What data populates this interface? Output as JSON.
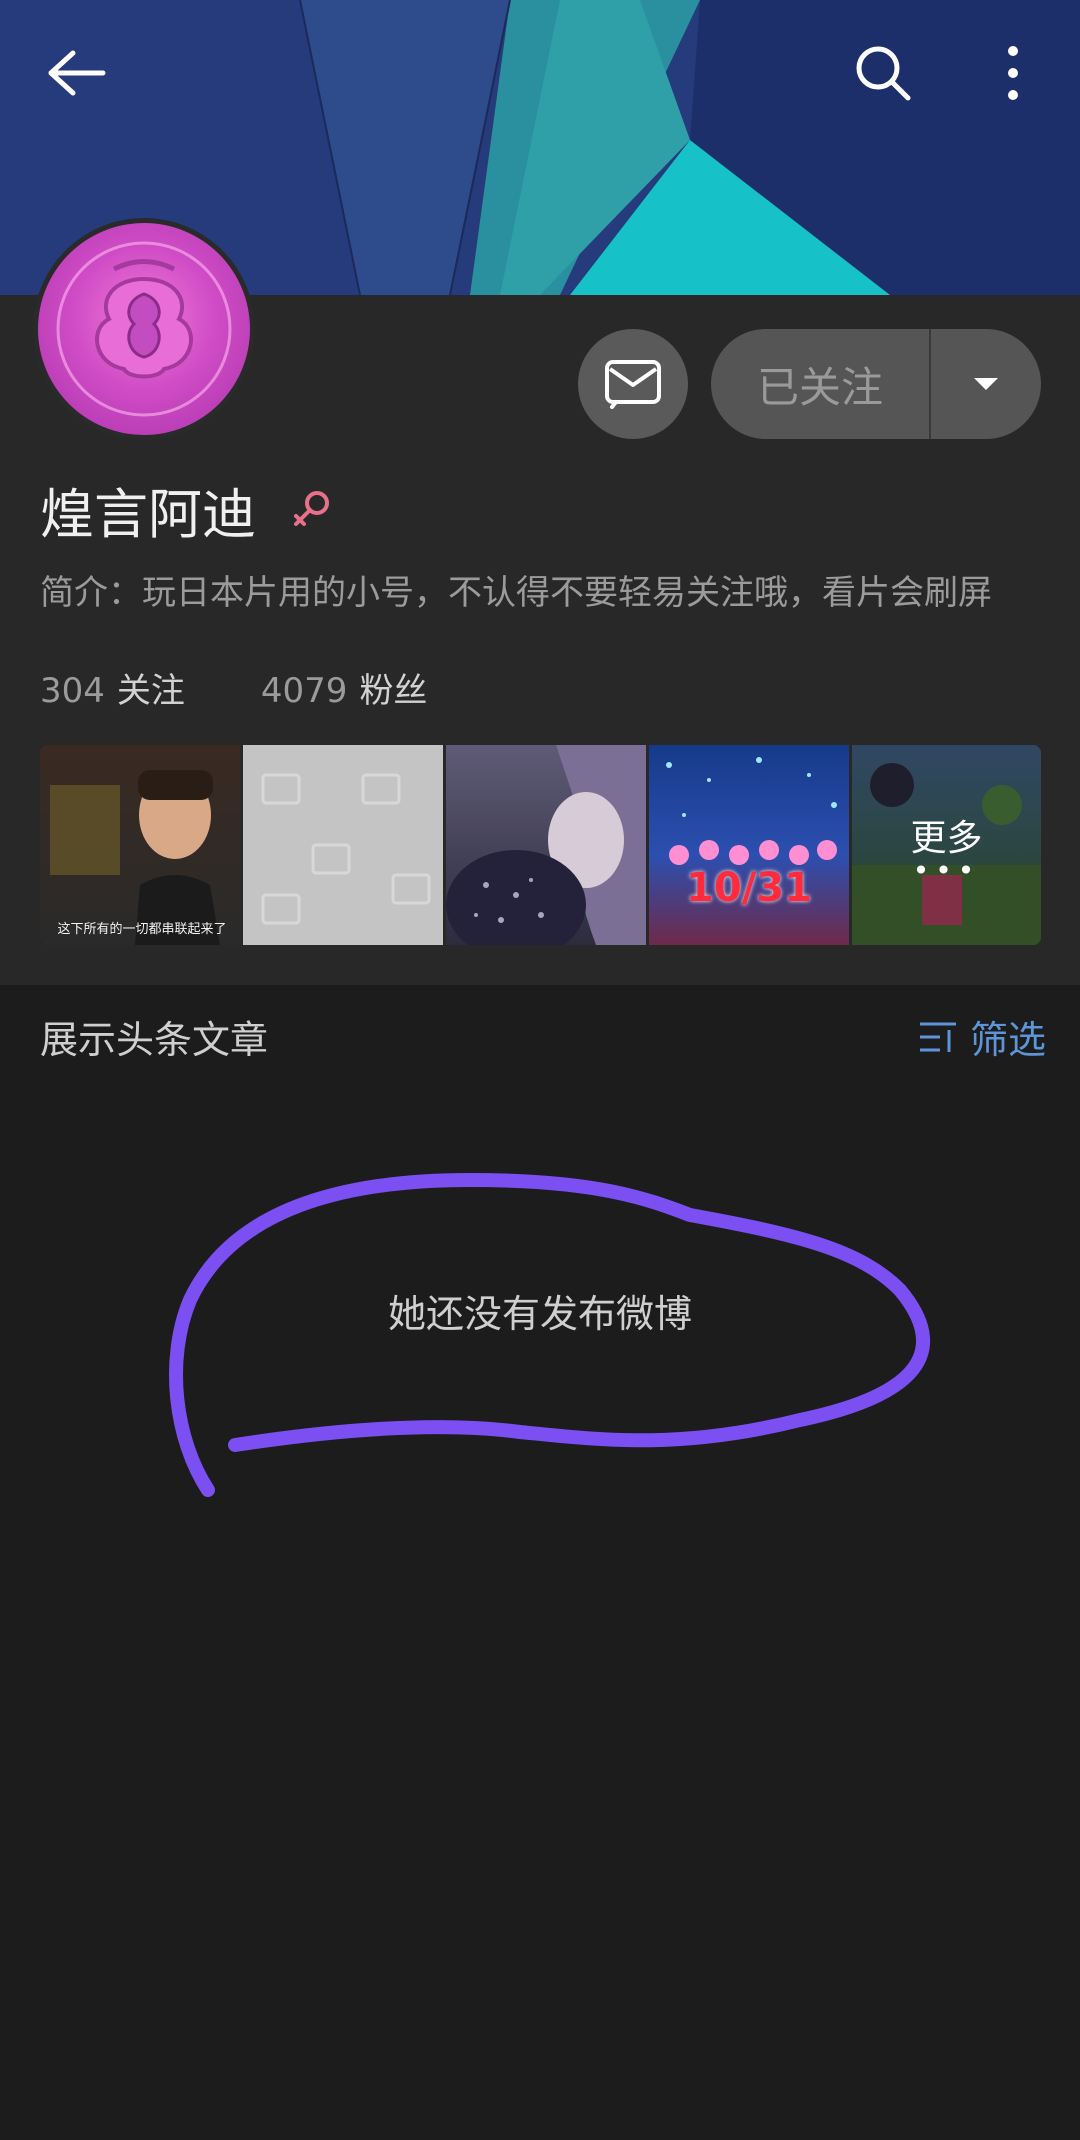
{
  "header": {
    "back_icon": "arrow-left-icon",
    "search_icon": "search-icon",
    "more_icon": "more-vertical-icon",
    "colors": [
      "#243a78",
      "#1f3066",
      "#2d4f8f",
      "#2fa3a8",
      "#15c2c8"
    ]
  },
  "profile": {
    "username": "煌言阿迪",
    "gender_icon": "female-symbol-icon",
    "bio": "简介：玩日本片用的小号，不认得不要轻易关注哦，看片会刷屏",
    "stats": [
      {
        "number": "304",
        "label": "关注"
      },
      {
        "number": "4079",
        "label": "粉丝"
      }
    ],
    "follow_button": "已关注",
    "message_icon": "message-icon"
  },
  "album": {
    "thumb1_caption": "这下所有的一切都串联起来了",
    "thumb4_text": "10/31",
    "more_label": "更多",
    "more_dots": "•••"
  },
  "section": {
    "title": "展示头条文章",
    "filter_label": "筛选",
    "filter_color": "#5d95d8"
  },
  "empty_state": {
    "text": "她还没有发布微博"
  },
  "annotation": {
    "color": "#7b4ff2"
  }
}
